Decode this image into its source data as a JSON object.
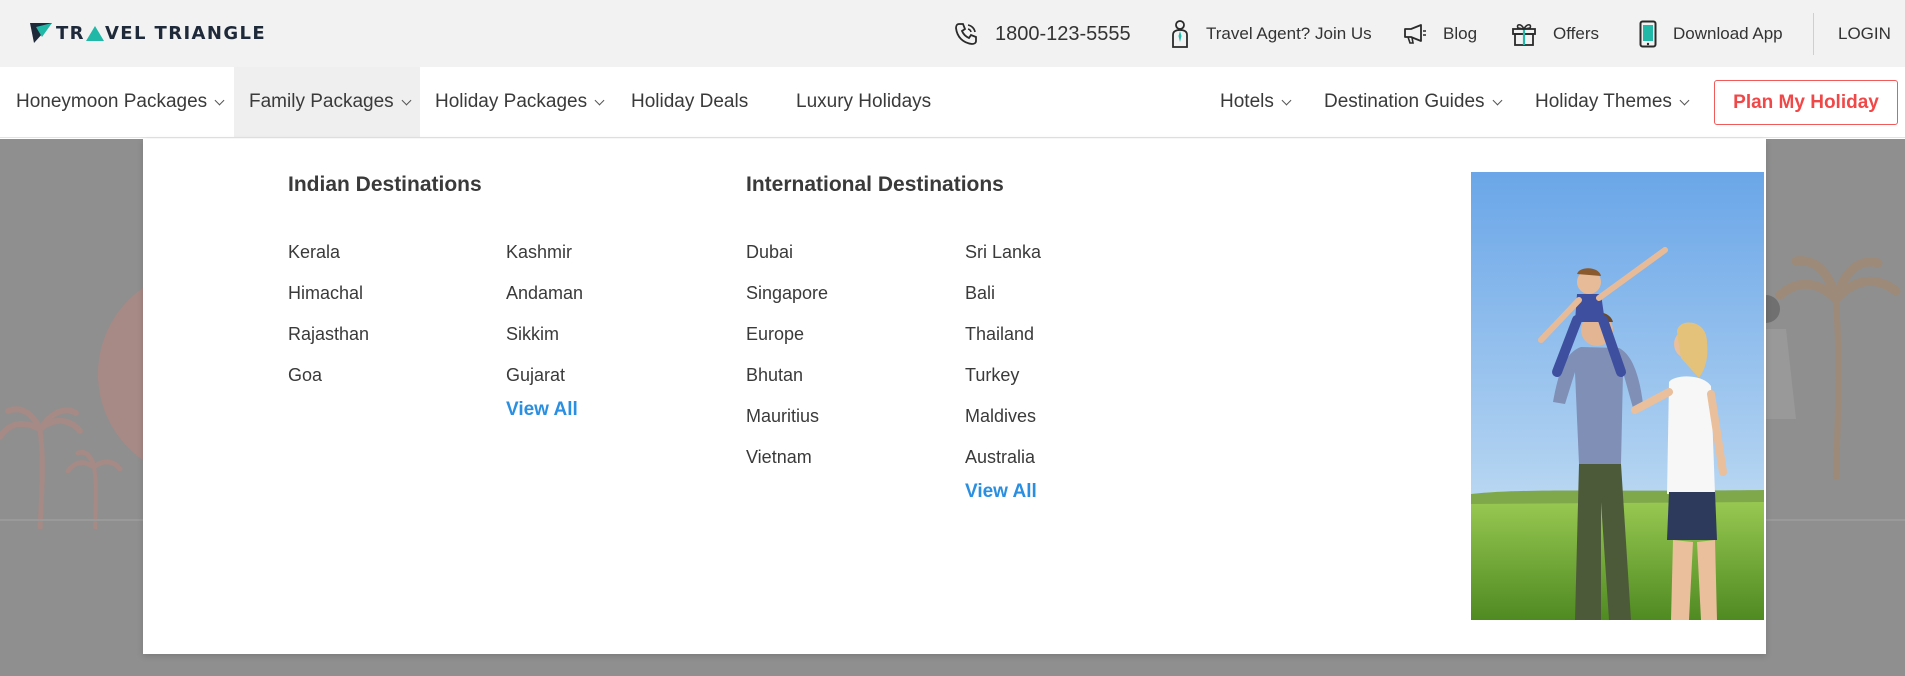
{
  "brand": {
    "name_part1": "TR",
    "name_part2": "VEL TRIANGLE",
    "accent": "#21b8a8"
  },
  "topbar": {
    "phone": "1800-123-5555",
    "travel_agent": "Travel Agent? Join Us",
    "blog": "Blog",
    "offers": "Offers",
    "download_app": "Download App",
    "login": "LOGIN"
  },
  "nav": {
    "items": [
      {
        "label": "Honeymoon Packages",
        "has_dropdown": true
      },
      {
        "label": "Family Packages",
        "has_dropdown": true,
        "active": true
      },
      {
        "label": "Holiday Packages",
        "has_dropdown": true
      },
      {
        "label": "Holiday Deals",
        "has_dropdown": false
      },
      {
        "label": "Luxury Holidays",
        "has_dropdown": false
      }
    ],
    "right_items": [
      {
        "label": "Hotels",
        "has_dropdown": true
      },
      {
        "label": "Destination Guides",
        "has_dropdown": true
      },
      {
        "label": "Holiday Themes",
        "has_dropdown": true
      }
    ],
    "cta": "Plan My Holiday",
    "cta_color": "#f04848"
  },
  "dropdown": {
    "indian": {
      "title": "Indian Destinations",
      "col1": [
        "Kerala",
        "Himachal",
        "Rajasthan",
        "Goa"
      ],
      "col2": [
        "Kashmir",
        "Andaman",
        "Sikkim",
        "Gujarat"
      ],
      "view_all": "View All"
    },
    "international": {
      "title": "International Destinations",
      "col1": [
        "Dubai",
        "Singapore",
        "Europe",
        "Bhutan",
        "Mauritius",
        "Vietnam"
      ],
      "col2": [
        "Sri Lanka",
        "Bali",
        "Thailand",
        "Turkey",
        "Maldives",
        "Australia"
      ],
      "view_all": "View All"
    },
    "link_color": "#2a8fe0"
  }
}
